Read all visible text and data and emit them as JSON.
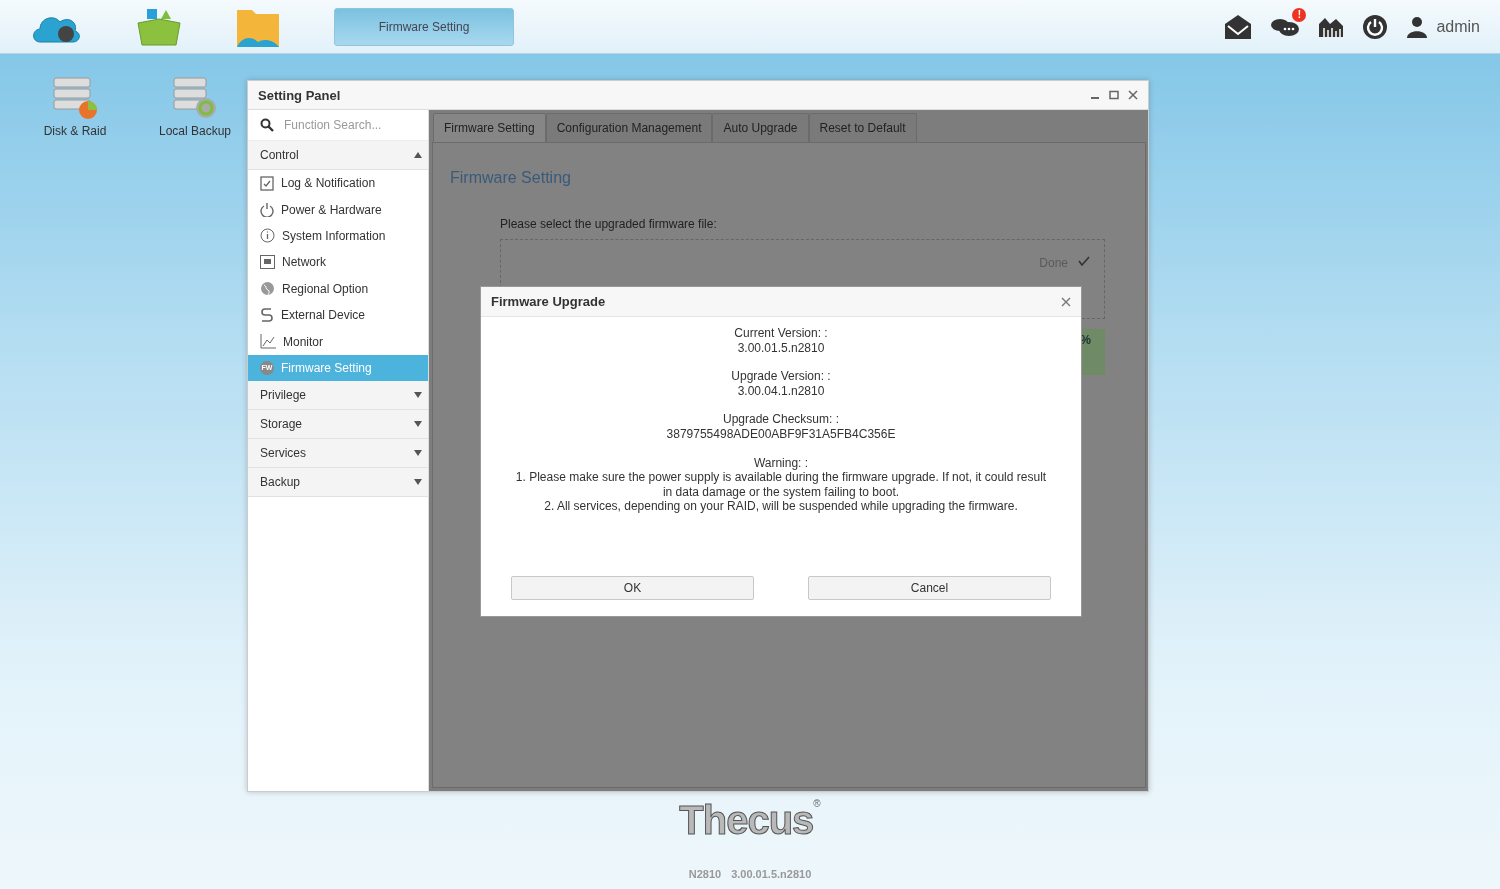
{
  "taskbar": {
    "apps": [
      {
        "kind": "cloud"
      },
      {
        "kind": "box"
      },
      {
        "kind": "folder"
      }
    ],
    "task": {
      "label": "Firmware Setting",
      "selected": true
    },
    "notifications": {
      "badge": "!"
    },
    "user": "admin"
  },
  "desktop_icons": [
    {
      "label": "Disk & Raid",
      "kind": "disk"
    },
    {
      "label": "Local Backup",
      "kind": "backup"
    }
  ],
  "setting_panel": {
    "title": "Setting Panel",
    "search": {
      "placeholder": "Function Search..."
    },
    "groups": [
      {
        "label": "Control",
        "expanded": true,
        "children": [
          {
            "label": "Log & Notification",
            "selected": false
          },
          {
            "label": "Power & Hardware",
            "selected": false
          },
          {
            "label": "System Information",
            "selected": false
          },
          {
            "label": "Network",
            "selected": false
          },
          {
            "label": "Regional Option",
            "selected": false
          },
          {
            "label": "External Device",
            "selected": false
          },
          {
            "label": "Monitor",
            "selected": false
          },
          {
            "label": "Firmware Setting",
            "selected": true,
            "icon_text": "FW"
          }
        ]
      },
      {
        "label": "Privilege",
        "expanded": false
      },
      {
        "label": "Storage",
        "expanded": false
      },
      {
        "label": "Services",
        "expanded": false
      },
      {
        "label": "Backup",
        "expanded": false
      }
    ],
    "tabs": [
      {
        "label": "Firmware Setting",
        "selected": true
      },
      {
        "label": "Configuration Management",
        "selected": false
      },
      {
        "label": "Auto Upgrade",
        "selected": false
      },
      {
        "label": "Reset to Default",
        "selected": false
      }
    ],
    "heading": "Firmware Setting",
    "prompt": "Please select the upgraded firmware file:",
    "upload_status": "Done",
    "progress_text": "%",
    "progress": {
      "level": 1
    }
  },
  "dialog": {
    "title": "Firmware Upgrade",
    "fields": [
      {
        "label": "Current Version: :",
        "value": "3.00.01.5.n2810"
      },
      {
        "label": "Upgrade Version: :",
        "value": "3.00.04.1.n2810"
      },
      {
        "label": "Upgrade Checksum: :",
        "value": "3879755498ADE00ABF9F31A5FB4C356E"
      }
    ],
    "warning": {
      "label": "Warning: :",
      "lines": [
        "1. Please make sure the power supply is available during the firmware upgrade. If not, it could result in data damage or the system failing to boot.",
        "2. All services, depending on your RAID, will be suspended while upgrading the firmware."
      ]
    },
    "buttons": [
      "OK",
      "Cancel"
    ]
  },
  "footer": {
    "logo": "Thecus",
    "registered": "®",
    "model": "N2810",
    "version": "3.00.01.5.n2810"
  }
}
